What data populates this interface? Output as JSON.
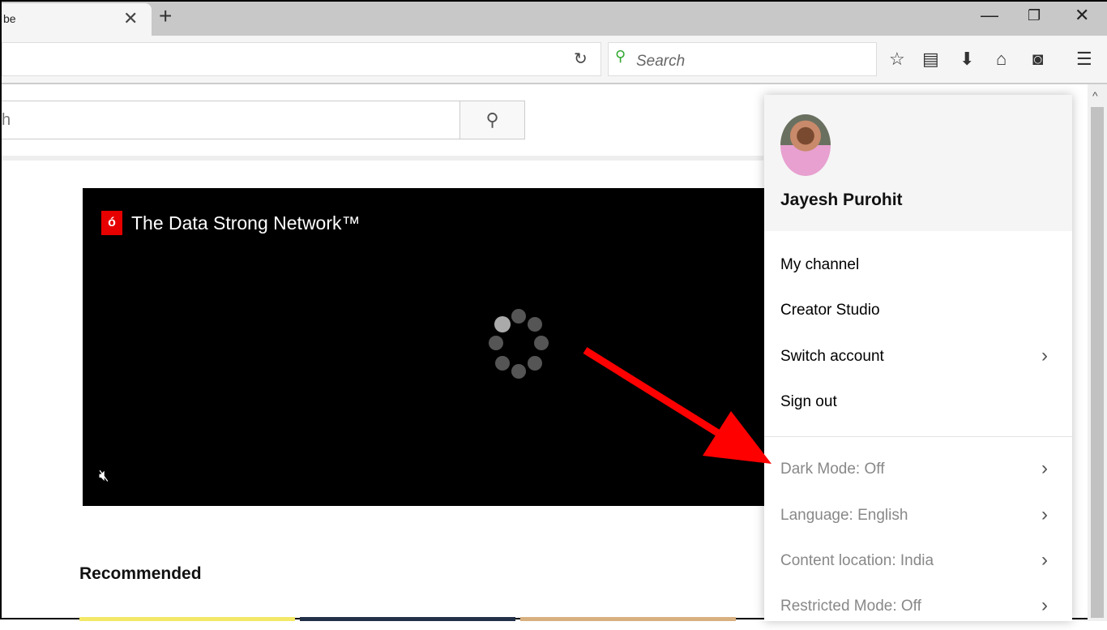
{
  "browser": {
    "tab_title": "be",
    "reload_icon": "reload-icon",
    "search_placeholder": "Search",
    "toolbar_icons": [
      "star-icon",
      "reading-list-icon",
      "download-icon",
      "home-icon",
      "pocket-icon",
      "menu-icon"
    ]
  },
  "youtube": {
    "search_partial": "h",
    "video_title": "The Data Strong Network™",
    "recommended": "Recommended"
  },
  "account_menu": {
    "user_name": "Jayesh Purohit",
    "items": [
      {
        "label": "My channel"
      },
      {
        "label": "Creator Studio"
      },
      {
        "label": "Switch account",
        "chevron": true
      },
      {
        "label": "Sign out"
      }
    ],
    "settings": [
      {
        "label": "Dark Mode: Off"
      },
      {
        "label": "Language: English"
      },
      {
        "label": "Content location: India"
      },
      {
        "label": "Restricted Mode: Off"
      }
    ]
  },
  "annotation": {
    "arrow_color": "#ff0000",
    "points_to": "Dark Mode: Off"
  }
}
